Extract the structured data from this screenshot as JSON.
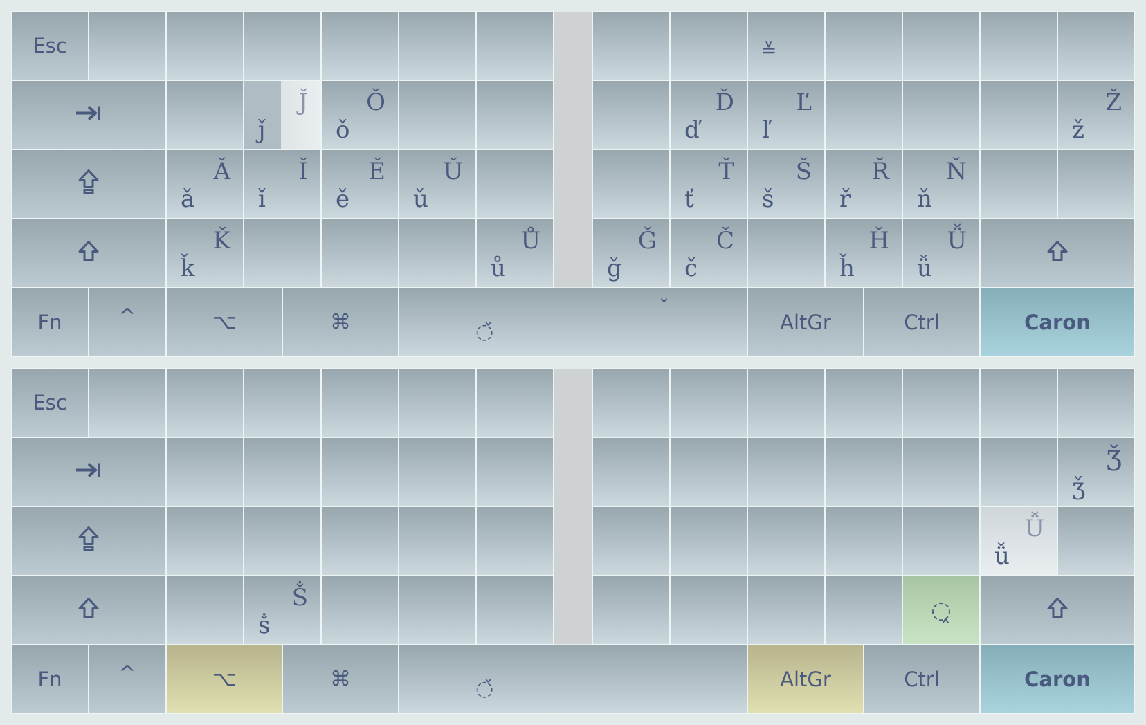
{
  "top": {
    "row0": {
      "esc": "Esc",
      "k10_lower": "≚"
    },
    "row1": {
      "k1_lower": "ǰ",
      "k1_upper": "J̌",
      "k2_lower": "ǒ",
      "k2_upper": "Ǒ",
      "r2_lower": "ď",
      "r2_upper": "Ď",
      "r3_lower": "ľ",
      "r3_upper": "Ľ",
      "r8_lower": "ž",
      "r8_upper": "Ž"
    },
    "row2": {
      "k0_lower": "ǎ",
      "k0_upper": "Ǎ",
      "k1_lower": "ǐ",
      "k1_upper": "Ǐ",
      "k2_lower": "ě",
      "k2_upper": "Ě",
      "k3_lower": "ǔ",
      "k3_upper": "Ǔ",
      "r2_lower": "ť",
      "r2_upper": "Ť",
      "r3_lower": "š",
      "r3_upper": "Š",
      "r4_lower": "ř",
      "r4_upper": "Ř",
      "r5_lower": "ň",
      "r5_upper": "Ň"
    },
    "row3": {
      "k0_lower": "ǩ",
      "k0_upper": "Ǩ",
      "k4_lower": "ů",
      "k4_upper": "Ů",
      "r1_lower": "ǧ",
      "r1_upper": "Ǧ",
      "r2_lower": "č",
      "r2_upper": "Č",
      "r4_lower": "ȟ",
      "r4_upper": "Ȟ",
      "r5_lower": "ǚ",
      "r5_upper": "Ǚ"
    },
    "row4": {
      "fn": "Fn",
      "ctrl_caret": "^",
      "option": "⌥",
      "command": "⌘",
      "space_mark": "◌̌",
      "space_caron": "ˇ",
      "altgr": "AltGr",
      "ctrl": "Ctrl",
      "caron": "Caron"
    }
  },
  "bottom": {
    "row0": {
      "esc": "Esc"
    },
    "row1": {
      "r8_lower": "ǯ",
      "r8_upper": "Ǯ"
    },
    "row2": {
      "r6_lower": "ǚ",
      "r6_upper": "Ǚ"
    },
    "row3": {
      "k1_lower": "ṧ",
      "k1_upper": "Ṧ",
      "r6_mark": "◌̭"
    },
    "row4": {
      "fn": "Fn",
      "ctrl_caret": "^",
      "option": "⌥",
      "command": "⌘",
      "space_mark": "◌̌",
      "altgr": "AltGr",
      "ctrl": "Ctrl",
      "caron": "Caron"
    }
  },
  "colors": {
    "key_top": "#98a6ae",
    "key_bottom": "#cbd8de",
    "caron_blue": "#a9d3de",
    "mod_yellow": "#e0e0b0",
    "dead_green": "#c9e4c4",
    "text": "#4a5a7e"
  },
  "icons": {
    "tab": "tab-right-icon",
    "caps": "caps-lock-icon",
    "shift": "shift-icon"
  }
}
